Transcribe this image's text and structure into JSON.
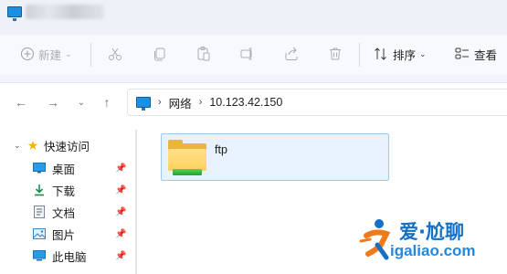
{
  "titlebar": {
    "title_redacted": true
  },
  "toolbar": {
    "new_label": "新建",
    "sort_label": "排序",
    "view_label": "查看"
  },
  "nav": {
    "breadcrumb": [
      "网络",
      "10.123.42.150"
    ]
  },
  "sidebar": {
    "items": [
      {
        "label": "快速访问",
        "icon": "star-icon",
        "pinned": false
      },
      {
        "label": "桌面",
        "icon": "desktop-icon",
        "pinned": true
      },
      {
        "label": "下载",
        "icon": "download-icon",
        "pinned": true
      },
      {
        "label": "文档",
        "icon": "document-icon",
        "pinned": true
      },
      {
        "label": "图片",
        "icon": "picture-icon",
        "pinned": true
      },
      {
        "label": "此电脑",
        "icon": "computer-icon",
        "pinned": true
      }
    ]
  },
  "main": {
    "items": [
      {
        "name": "ftp",
        "icon": "network-folder-icon"
      }
    ]
  },
  "watermark": {
    "line1": "爱·尬聊",
    "line2": "igaliao.com"
  },
  "colors": {
    "accent": "#1d8fe0",
    "selection_bg": "#e8f2fd",
    "selection_border": "#9ccaf2",
    "folder": "#ffd15c",
    "watermark_blue": "#1570c6",
    "watermark_orange": "#f07a1a"
  }
}
